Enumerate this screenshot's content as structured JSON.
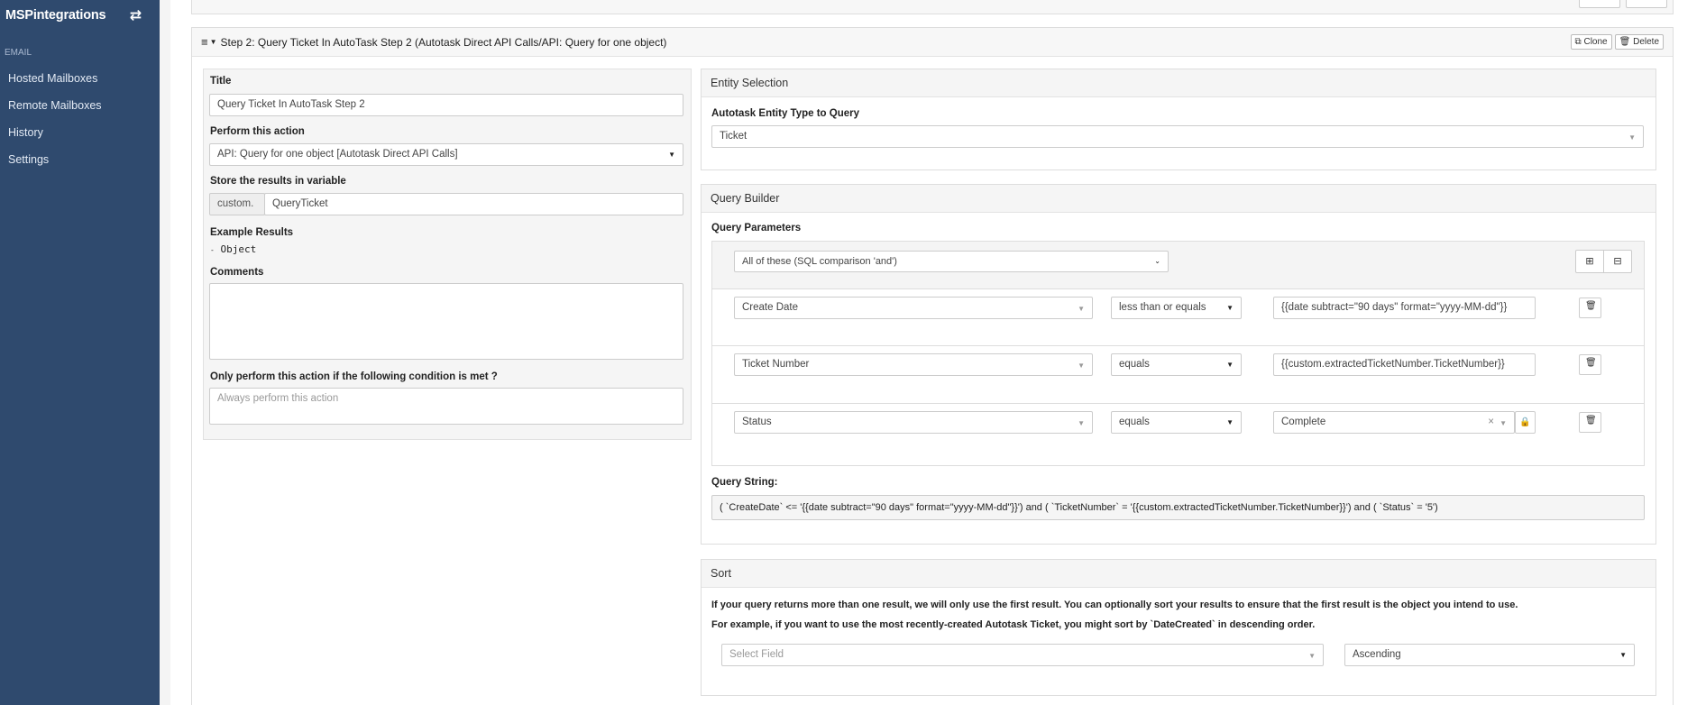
{
  "sidebar": {
    "brand": "MSPintegrations",
    "swap_icon": "arrows-swap-icon",
    "section": "EMAIL",
    "items": [
      {
        "label": "Hosted Mailboxes"
      },
      {
        "label": "Remote Mailboxes"
      },
      {
        "label": "History"
      },
      {
        "label": "Settings"
      }
    ]
  },
  "step": {
    "header": "Step 2: Query Ticket In AutoTask Step 2 (Autotask Direct API Calls/API: Query for one object)",
    "clone_label": "Clone",
    "delete_label": "Delete"
  },
  "left": {
    "title_label": "Title",
    "title_value": "Query Ticket In AutoTask Step 2",
    "perform_label": "Perform this action",
    "perform_value": "API: Query for one object [Autotask Direct API Calls]",
    "store_label": "Store the results in variable",
    "store_prefix": "custom.",
    "store_value": "QueryTicket",
    "example_label": "Example Results",
    "example_value": "Object",
    "comments_label": "Comments",
    "condition_label": "Only perform this action if the following condition is met",
    "condition_placeholder": "Always perform this action"
  },
  "entity": {
    "header": "Entity Selection",
    "type_label": "Autotask Entity Type to Query",
    "type_value": "Ticket"
  },
  "query": {
    "header": "Query Builder",
    "params_label": "Query Parameters",
    "combinator": "All of these (SQL comparison 'and')",
    "rules": [
      {
        "field": "Create Date",
        "op": "less than or equals",
        "value": "{{date subtract=\"90 days\" format=\"yyyy-MM-dd\"}}"
      },
      {
        "field": "Ticket Number",
        "op": "equals",
        "value": "{{custom.extractedTicketNumber.TicketNumber}}"
      },
      {
        "field": "Status",
        "op": "equals",
        "value": "Complete"
      }
    ],
    "string_label": "Query String:",
    "string_value": "( `CreateDate` <= '{{date subtract=\"90 days\" format=\"yyyy-MM-dd\"}}') and ( `TicketNumber` = '{{custom.extractedTicketNumber.TicketNumber}}') and ( `Status` = '5')"
  },
  "sort": {
    "header": "Sort",
    "text1": "If your query returns more than one result, we will only use the first result. You can optionally sort your results to ensure that the first result is the object you intend to use.",
    "text2": "For example, if you want to use the most recently-created Autotask Ticket, you might sort by `DateCreated` in descending order.",
    "field_placeholder": "Select Field",
    "order_value": "Ascending"
  }
}
